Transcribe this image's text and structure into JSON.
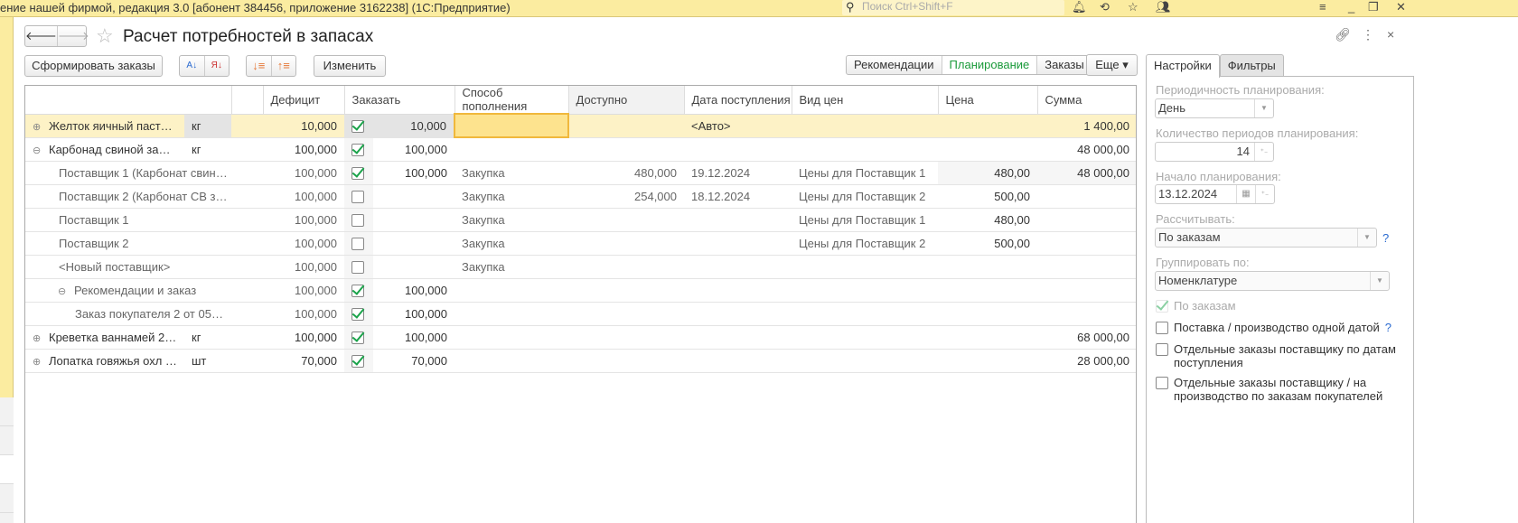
{
  "app": {
    "title": "ение нашей фирмой, редакция 3.0 [абонент 384456, приложение 3162238]  (1С:Предприятие)",
    "search_placeholder": "Поиск Ctrl+Shift+F"
  },
  "form": {
    "title": "Расчет потребностей в запасах",
    "back": "🡐",
    "forward": "🡒"
  },
  "toolbar": {
    "create_orders": "Сформировать заказы",
    "edit": "Изменить",
    "more": "Еще ▾",
    "tabs": [
      "Рекомендации",
      "Планирование",
      "Заказы"
    ],
    "active_tab": "Планирование"
  },
  "columns": [
    "",
    "Дефицит",
    "Заказать",
    "Способ пополнения",
    "Доступно",
    "Дата поступления",
    "Вид цен",
    "Цена",
    "Сумма"
  ],
  "rows": [
    {
      "exp": "⊕",
      "name": "Желток яичный пасте…",
      "unit": "кг",
      "deficit": "10,000",
      "checked": true,
      "order": "10,000",
      "method": "",
      "avail": "",
      "date": "<Авто>",
      "ptype": "",
      "price": "",
      "sum": "1 400,00"
    },
    {
      "exp": "⊖",
      "name": "Карбонад свиной замо…",
      "unit": "кг",
      "deficit": "100,000",
      "checked": true,
      "order": "100,000",
      "method": "",
      "avail": "",
      "date": "",
      "ptype": "",
      "price": "",
      "sum": "48 000,00"
    },
    {
      "exp": "",
      "name": "Поставщик 1 (Карбонат свин…",
      "unit": "",
      "deficit": "100,000",
      "checked": true,
      "order": "100,000",
      "method": "Закупка",
      "avail": "480,000",
      "date": "19.12.2024",
      "ptype": "Цены для Поставщик 1",
      "price": "480,00",
      "sum": "48 000,00"
    },
    {
      "exp": "",
      "name": "Поставщик 2 (Карбонат СВ з…",
      "unit": "",
      "deficit": "100,000",
      "checked": false,
      "order": "",
      "method": "Закупка",
      "avail": "254,000",
      "date": "18.12.2024",
      "ptype": "Цены для Поставщик 2",
      "price": "500,00",
      "sum": ""
    },
    {
      "exp": "",
      "name": "Поставщик 1",
      "unit": "",
      "deficit": "100,000",
      "checked": false,
      "order": "",
      "method": "Закупка",
      "avail": "",
      "date": "",
      "ptype": "Цены для Поставщик 1",
      "price": "480,00",
      "sum": ""
    },
    {
      "exp": "",
      "name": "Поставщик 2",
      "unit": "",
      "deficit": "100,000",
      "checked": false,
      "order": "",
      "method": "Закупка",
      "avail": "",
      "date": "",
      "ptype": "Цены для Поставщик 2",
      "price": "500,00",
      "sum": ""
    },
    {
      "exp": "",
      "name": "<Новый поставщик>",
      "unit": "",
      "deficit": "100,000",
      "checked": false,
      "order": "",
      "method": "Закупка",
      "avail": "",
      "date": "",
      "ptype": "",
      "price": "",
      "sum": ""
    },
    {
      "exp": "⊖",
      "name": "Рекомендации и заказ",
      "unit": "",
      "deficit": "100,000",
      "checked": true,
      "order": "100,000",
      "method": "",
      "avail": "",
      "date": "",
      "ptype": "",
      "price": "",
      "sum": ""
    },
    {
      "exp": "",
      "name": "Заказ покупателя 2 от 05…",
      "unit": "",
      "deficit": "100,000",
      "checked": true,
      "order": "100,000",
      "method": "",
      "avail": "",
      "date": "",
      "ptype": "",
      "price": "",
      "sum": ""
    },
    {
      "exp": "⊕",
      "name": "Креветка ваннамей 26…",
      "unit": "кг",
      "deficit": "100,000",
      "checked": true,
      "order": "100,000",
      "method": "",
      "avail": "",
      "date": "",
      "ptype": "",
      "price": "",
      "sum": "68 000,00"
    },
    {
      "exp": "⊕",
      "name": "Лопатка говяжья охл …",
      "unit": "шт",
      "deficit": "70,000",
      "checked": true,
      "order": "70,000",
      "method": "",
      "avail": "",
      "date": "",
      "ptype": "",
      "price": "",
      "sum": "28 000,00"
    }
  ],
  "settings": {
    "tabs": [
      "Настройки",
      "Фильтры"
    ],
    "period_label": "Периодичность планирования:",
    "period_value": "День",
    "count_label": "Количество периодов планирования:",
    "count_value": "14",
    "start_label": "Начало планирования:",
    "start_value": "13.12.2024",
    "calc_label": "Рассчитывать:",
    "calc_value": "По заказам",
    "group_label": "Группировать по:",
    "group_value": "Номенклатуре",
    "by_orders": "По заказам",
    "opt1": "Поставка / производство одной датой",
    "opt2": "Отдельные заказы поставщику по датам поступления",
    "opt3": "Отдельные заказы поставщику / на производство по заказам покупателей",
    "help": "?"
  }
}
